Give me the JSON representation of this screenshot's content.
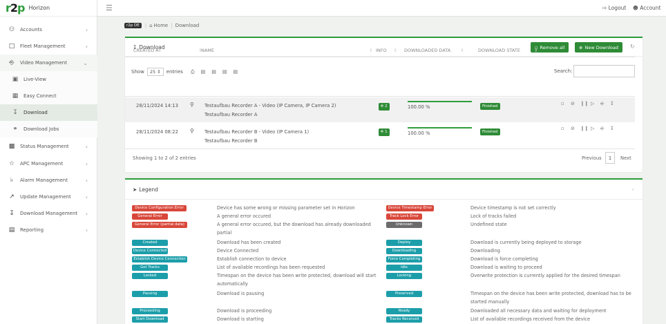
{
  "brand": {
    "logo": "r2p",
    "name": "Horizon"
  },
  "topbar": {
    "logout": "Logout",
    "account": "Account"
  },
  "sidebar": {
    "items": [
      {
        "label": "Accounts",
        "icon": "users-icon",
        "chevron": "‹"
      },
      {
        "label": "Fleet Management",
        "icon": "fleet-icon",
        "chevron": "‹"
      },
      {
        "label": "Video Management",
        "icon": "camera-icon",
        "chevron": "⌄"
      },
      {
        "label": "Live-View",
        "icon": "monitor-icon"
      },
      {
        "label": "Easy Connect",
        "icon": "grid-icon"
      },
      {
        "label": "Download",
        "icon": "download-icon"
      },
      {
        "label": "Download Jobs",
        "icon": "jobs-icon"
      },
      {
        "label": "Status Management",
        "icon": "status-icon",
        "chevron": "‹"
      },
      {
        "label": "APC Management",
        "icon": "star-icon",
        "chevron": "‹"
      },
      {
        "label": "Alarm Management",
        "icon": "bell-icon",
        "chevron": "‹"
      },
      {
        "label": "Update Management",
        "icon": "update-icon",
        "chevron": "‹"
      },
      {
        "label": "Download Management",
        "icon": "download-mgmt-icon",
        "chevron": "‹"
      },
      {
        "label": "Reporting",
        "icon": "report-icon",
        "chevron": "‹"
      }
    ]
  },
  "breadcrumb": {
    "tag": "r2p DE",
    "home": "Home",
    "current": "Download"
  },
  "download": {
    "title": "Download",
    "remove_all": "Remove all",
    "new_download": "New Download",
    "show": "Show",
    "entries_value": "25",
    "entries": "entries",
    "search": "Search:",
    "headers": [
      "CREATED AT",
      "NAME",
      "INFO",
      "DOWNLOADED DATA",
      "DOWNLOAD STATE"
    ],
    "rows": [
      {
        "created": "28/11/2024 14:13",
        "name": "Testaufbau Recorder A - Video (IP Camera, IP Camera 2)",
        "sub": "Testaufbau Recorder A",
        "info": "2",
        "progress_label": "100.00 %",
        "progress": 1.0,
        "state": "Finished"
      },
      {
        "created": "28/11/2024 08:22",
        "name": "Testaufbau Recorder B - Video (IP Camera 1)",
        "sub": "Testaufbau Recorder B",
        "info": "1",
        "progress_label": "100.00 %",
        "progress": 1.0,
        "state": "Finished"
      }
    ],
    "showing": "Showing 1 to 2 of 2 entries",
    "prev": "Previous",
    "page": "1",
    "next": "Next"
  },
  "legend": {
    "title": "Legend",
    "left": [
      {
        "badge": "Device Configuration Error",
        "color": "red",
        "desc": "Device has some wrong or missing parameter set in Horizon"
      },
      {
        "badge": "General Error",
        "color": "red",
        "desc": "A general error occured"
      },
      {
        "badge": "General Error (partial data)",
        "color": "red",
        "desc": "A general error occured, but the download has already downloaded",
        "desc2": "partial"
      },
      {
        "badge": "Created",
        "color": "teal",
        "desc": "Download has been created"
      },
      {
        "badge": "Device Connected",
        "color": "teal",
        "desc": "Device Connected"
      },
      {
        "badge": "Establish Device Connection",
        "color": "teal",
        "desc": "Establish connection to device"
      },
      {
        "badge": "Get Tracks",
        "color": "teal",
        "desc": "List of available recordings has been requested"
      },
      {
        "badge": "Locked",
        "color": "teal",
        "desc": "Timespan on the device has been write protected, download will start",
        "desc2": "automatically"
      },
      {
        "badge": "Pausing",
        "color": "teal",
        "desc": "Download is pausing"
      },
      {
        "badge": "Proceeding",
        "color": "teal",
        "desc": "Download is proceeding"
      },
      {
        "badge": "Start Download",
        "color": "teal",
        "desc": "Download is starting"
      }
    ],
    "right": [
      {
        "badge": "Device Timestamp Error",
        "color": "red",
        "desc": "Device timestamp is not set correctly"
      },
      {
        "badge": "Track Lock Error",
        "color": "red",
        "desc": "Lock of tracks failed"
      },
      {
        "badge": "Unknown",
        "color": "gray",
        "desc": "Undefined state"
      },
      {
        "badge": "Deploy",
        "color": "teal",
        "desc": "Download is currently being deployed to storage"
      },
      {
        "badge": "Downloading",
        "color": "teal",
        "desc": "Downloading"
      },
      {
        "badge": "Force Completing",
        "color": "teal",
        "desc": "Download is force completing"
      },
      {
        "badge": "Idle",
        "color": "teal",
        "desc": "Download is waiting to proceed"
      },
      {
        "badge": "Locking",
        "color": "teal",
        "desc": "Overwrite protection is currently applied for the desired timespan"
      },
      {
        "badge": "Preserved",
        "color": "teal",
        "desc": "Timespan on the device has been write protected, download has to be",
        "desc2": "started manually"
      },
      {
        "badge": "Ready",
        "color": "teal",
        "desc": "Downloaded all necessary data and waiting for deployment"
      },
      {
        "badge": "Tracks Received",
        "color": "teal",
        "desc": "List of available recordings received from the device"
      }
    ]
  },
  "colors": {
    "accent": "#2e9d3b",
    "error": "#d9473a",
    "info": "#1c9eaa",
    "unknown": "#6b6b6b"
  }
}
